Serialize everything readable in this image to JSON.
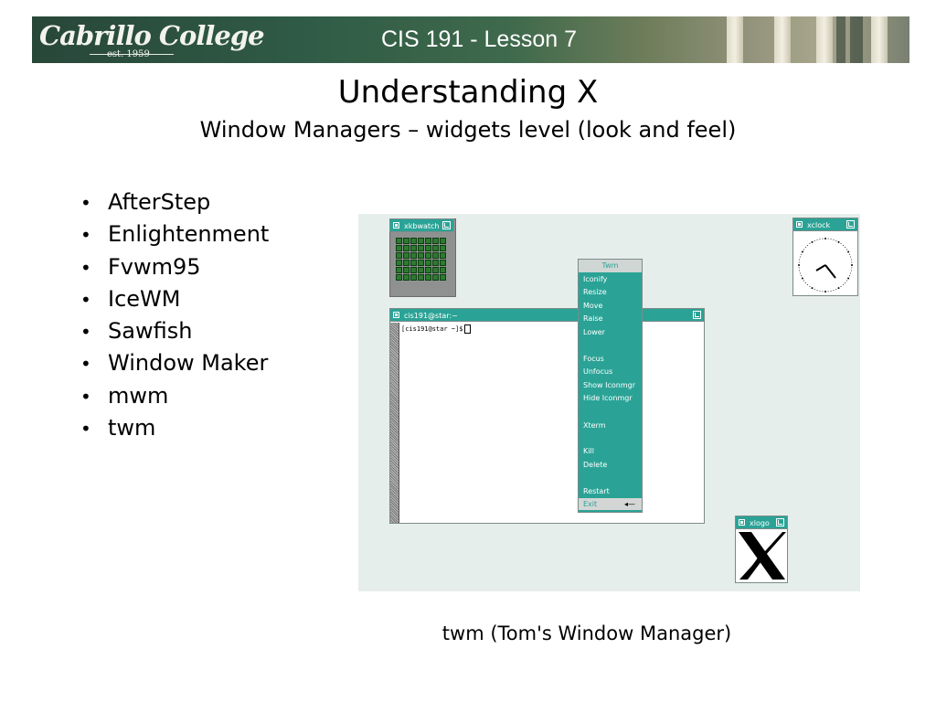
{
  "header": {
    "logo_script": "Cabrillo College",
    "logo_est": "est. 1959",
    "course_title": "CIS 191 - Lesson 7"
  },
  "slide": {
    "title": "Understanding X",
    "subtitle": "Window Managers – widgets level (look and feel)"
  },
  "bullets": [
    "AfterStep",
    "Enlightenment",
    "Fvwm95",
    "IceWM",
    "Sawfish",
    "Window Maker",
    "mwm",
    "twm"
  ],
  "screenshot": {
    "xkbwatch_title": "xkbwatch",
    "xclock_title": "xclock",
    "terminal_title": "cis191@star:~",
    "terminal_prompt": "[cis191@star ~]$",
    "xlogo_title": "xlogo",
    "menu": {
      "title": "Twm",
      "items": [
        "Iconify",
        "Resize",
        "Move",
        "Raise",
        "Lower",
        "Focus",
        "Unfocus",
        "Show Iconmgr",
        "Hide Iconmgr",
        "Xterm",
        "Kill",
        "Delete",
        "Restart"
      ],
      "exit_label": "Exit"
    },
    "colors": {
      "titlebar": "#2aa396",
      "desktop": "#e6eeec"
    }
  },
  "caption": "twm (Tom's Window Manager)"
}
